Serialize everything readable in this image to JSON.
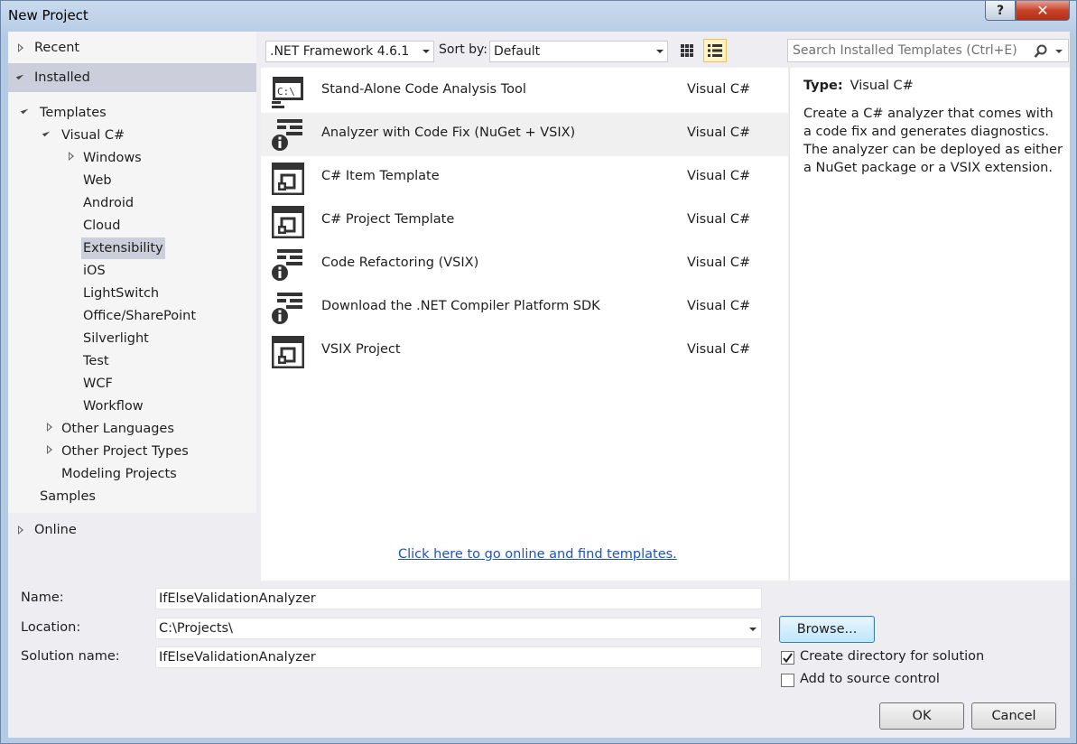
{
  "window": {
    "title": "New Project",
    "help": "?",
    "close": "✕"
  },
  "tree": {
    "recent": "Recent",
    "installed": "Installed",
    "templates": "Templates",
    "visual_cs": "Visual C#",
    "cs_children": [
      "Windows",
      "Web",
      "Android",
      "Cloud",
      "Extensibility",
      "iOS",
      "LightSwitch",
      "Office/SharePoint",
      "Silverlight",
      "Test",
      "WCF",
      "Workflow"
    ],
    "other_languages": "Other Languages",
    "other_project_types": "Other Project Types",
    "modeling_projects": "Modeling Projects",
    "samples": "Samples",
    "online": "Online",
    "selected": "Extensibility"
  },
  "toolbar": {
    "framework": ".NET Framework 4.6.1",
    "sort_label": "Sort by:",
    "sort_value": "Default"
  },
  "search": {
    "placeholder": "Search Installed Templates (Ctrl+E)"
  },
  "templates": [
    {
      "name": "Stand-Alone Code Analysis Tool",
      "lang": "Visual C#",
      "icon": "console-icon"
    },
    {
      "name": "Analyzer with Code Fix (NuGet + VSIX)",
      "lang": "Visual C#",
      "icon": "analyzer-icon"
    },
    {
      "name": "C# Item Template",
      "lang": "Visual C#",
      "icon": "vsix-icon"
    },
    {
      "name": "C# Project Template",
      "lang": "Visual C#",
      "icon": "vsix-icon"
    },
    {
      "name": "Code Refactoring (VSIX)",
      "lang": "Visual C#",
      "icon": "analyzer-icon"
    },
    {
      "name": "Download the .NET Compiler Platform SDK",
      "lang": "Visual C#",
      "icon": "analyzer-icon"
    },
    {
      "name": "VSIX Project",
      "lang": "Visual C#",
      "icon": "vsix-icon"
    }
  ],
  "online_link": "Click here to go online and find templates.",
  "description": {
    "type_label": "Type:",
    "type_value": "Visual C#",
    "text": "Create a C# analyzer that comes with a code fix and generates diagnostics. The analyzer can be deployed as either a NuGet package or a VSIX extension."
  },
  "form": {
    "name_label": "Name:",
    "name_value": "IfElseValidationAnalyzer",
    "location_label": "Location:",
    "location_value": "C:\\Projects\\",
    "solution_label": "Solution name:",
    "solution_value": "IfElseValidationAnalyzer",
    "browse": "Browse...",
    "create_dir": "Create directory for solution",
    "create_dir_checked": true,
    "source_control": "Add to source control",
    "source_control_checked": false,
    "ok": "OK",
    "cancel": "Cancel"
  }
}
